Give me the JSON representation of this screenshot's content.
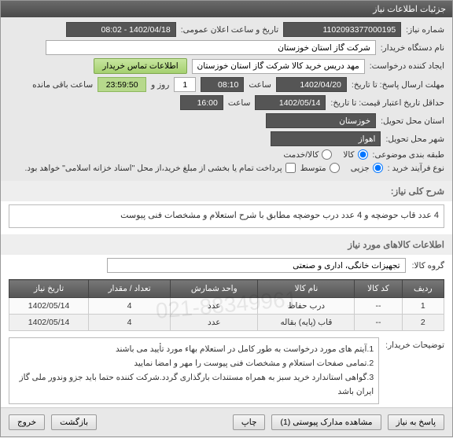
{
  "title": "جزئیات اطلاعات نیاز",
  "form": {
    "need_no_lbl": "شماره نیاز:",
    "need_no": "1102093377000195",
    "announce_lbl": "تاریخ و ساعت اعلان عمومی:",
    "announce": "1402/04/18 - 08:02",
    "org_lbl": "نام دستگاه خریدار:",
    "org": "شرکت گاز استان خوزستان",
    "creator_lbl": "ایجاد کننده درخواست:",
    "creator": "مهد دریس خرید کالا شرکت گاز استان خوزستان",
    "contact_btn": "اطلاعات تماس خریدار",
    "deadline_lbl": "مهلت ارسال پاسخ: تا تاریخ:",
    "deadline_date": "1402/04/20",
    "time_lbl": "ساعت",
    "deadline_time": "08:10",
    "day_lbl": "روز و",
    "days": "1",
    "remain_lbl": "ساعت باقی مانده",
    "remain": "23:59:50",
    "valid_lbl": "حداقل تاریخ اعتبار قیمت: تا تاریخ:",
    "valid_date": "1402/05/14",
    "valid_time": "16:00",
    "province_lbl": "استان محل تحویل:",
    "province": "خوزستان",
    "city_lbl": "شهر محل تحویل:",
    "city": "اهواز",
    "cat_lbl": "طبقه بندی موضوعی:",
    "cat_goods": "کالا",
    "cat_service": "کالا/خدمت",
    "proc_lbl": "نوع فرآیند خرید :",
    "proc_part": "جزیی",
    "proc_mid": "متوسط",
    "payment_note": "پرداخت تمام یا بخشی از مبلغ خرید،از محل \"اسناد خزانه اسلامی\" خواهد بود."
  },
  "desc": {
    "title": "شرح کلی نیاز:",
    "text": "4 عدد قاب حوضچه و 4 عدد درب حوضچه مطابق با شرح استعلام و مشخصات فنی پیوست"
  },
  "items": {
    "section": "اطلاعات کالاهای مورد نیاز",
    "group_lbl": "گروه کالا:",
    "group": "تجهیزات خانگی، اداری و صنعتی",
    "headers": {
      "row": "ردیف",
      "code": "کد کالا",
      "name": "نام کالا",
      "unit": "واحد شمارش",
      "qty": "تعداد / مقدار",
      "date": "تاریخ نیاز"
    },
    "rows": [
      {
        "row": "1",
        "code": "--",
        "name": "درب حفاظ",
        "unit": "عدد",
        "qty": "4",
        "date": "1402/05/14"
      },
      {
        "row": "2",
        "code": "--",
        "name": "قاب (پایه) بقاله",
        "unit": "عدد",
        "qty": "4",
        "date": "1402/05/14"
      }
    ]
  },
  "buyer_desc": {
    "lbl": "توضیحات خریدار:",
    "line1": "1.آیتم های مورد درخواست به طور کامل در استعلام بهاء مورد تأیید می باشند",
    "line2": "2.تمامی صفحات استعلام و مشخصات فنی پیوست را مهر و امضا نمایید",
    "line3": "3.گواهی استاندارد خرید سبز به همراه مستندات بارگذاری گردد.شرکت کننده حتما باید جزو وندور ملی گاز ایران باشد"
  },
  "actions": {
    "reply": "پاسخ به نیاز",
    "attach": "مشاهده مدارک پیوستی (1)",
    "print": "چاپ",
    "back": "بازگشت",
    "exit": "خروج"
  }
}
